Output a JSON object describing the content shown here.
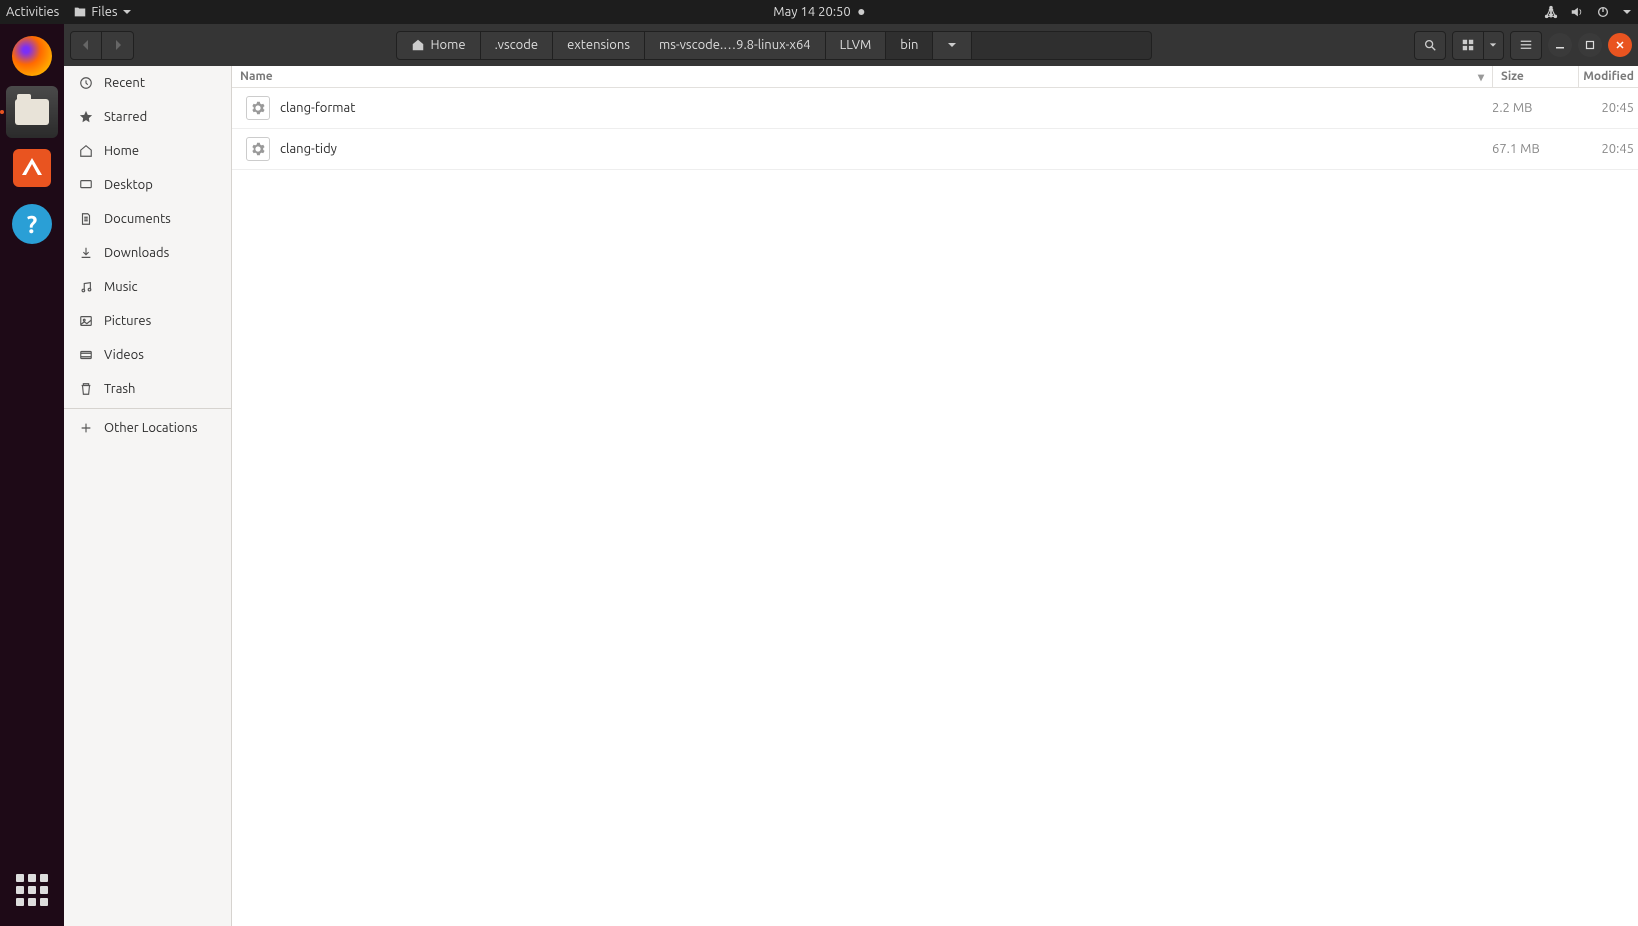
{
  "top_panel": {
    "activities": "Activities",
    "app_name": "Files",
    "clock": "May 14  20:50"
  },
  "dock": {
    "items": [
      {
        "name": "firefox",
        "active": false
      },
      {
        "name": "files",
        "active": true
      },
      {
        "name": "software",
        "active": false
      },
      {
        "name": "help",
        "active": false
      }
    ]
  },
  "breadcrumb": [
    {
      "label": "Home",
      "has_icon": true
    },
    {
      "label": ".vscode"
    },
    {
      "label": "extensions"
    },
    {
      "label": "ms-vscode.…9.8-linux-x64"
    },
    {
      "label": "LLVM"
    },
    {
      "label": "bin",
      "current": true
    }
  ],
  "sidebar": {
    "items": [
      {
        "icon": "recent",
        "label": "Recent"
      },
      {
        "icon": "star",
        "label": "Starred"
      },
      {
        "icon": "home",
        "label": "Home"
      },
      {
        "icon": "desktop",
        "label": "Desktop"
      },
      {
        "icon": "documents",
        "label": "Documents"
      },
      {
        "icon": "downloads",
        "label": "Downloads"
      },
      {
        "icon": "music",
        "label": "Music"
      },
      {
        "icon": "pictures",
        "label": "Pictures"
      },
      {
        "icon": "videos",
        "label": "Videos"
      },
      {
        "icon": "trash",
        "label": "Trash"
      }
    ],
    "other_locations": "Other Locations"
  },
  "columns": {
    "name": "Name",
    "size": "Size",
    "modified": "Modified"
  },
  "files": [
    {
      "name": "clang-format",
      "size": "2.2 MB",
      "modified": "20:45"
    },
    {
      "name": "clang-tidy",
      "size": "67.1 MB",
      "modified": "20:45"
    }
  ]
}
